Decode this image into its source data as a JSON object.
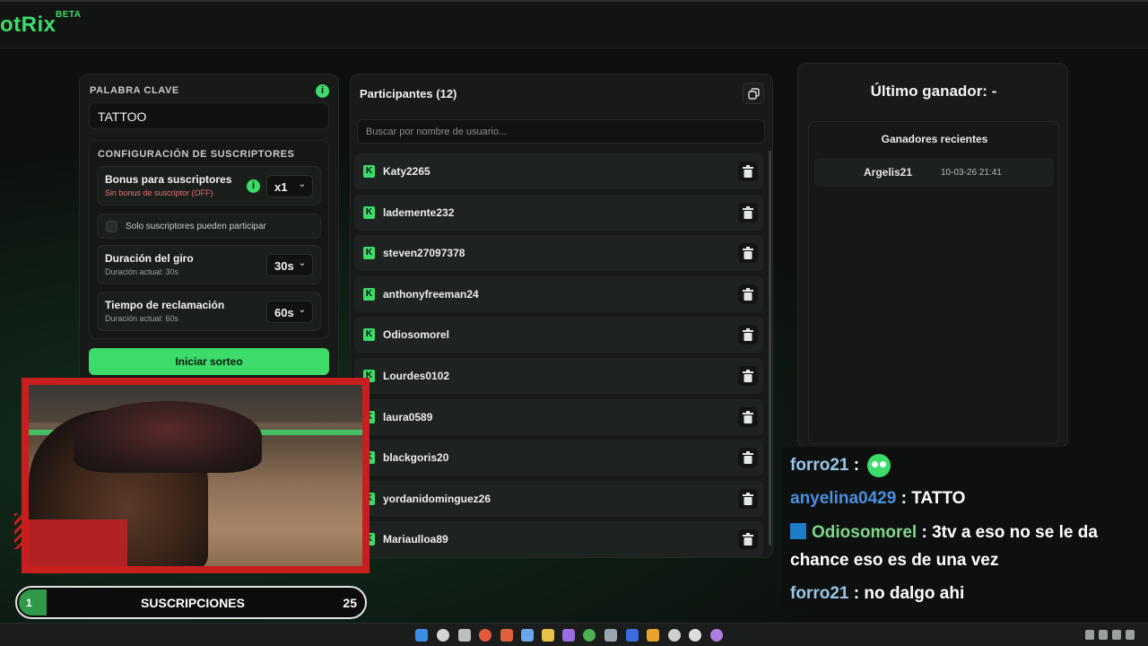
{
  "app": {
    "logo": "otRix",
    "beta": "BETA"
  },
  "keyword": {
    "label": "PALABRA CLAVE",
    "value": "TATTOO",
    "info": "i"
  },
  "subscriber_config": {
    "title": "CONFIGURACIÓN DE SUSCRIPTORES",
    "bonus": {
      "title": "Bonus para suscriptores",
      "subtitle": "Sin bonus de suscriptor (OFF)",
      "value": "x1",
      "info": "i"
    },
    "only_subs": {
      "label": "Solo suscriptores pueden participar",
      "checked": false
    },
    "spin_duration": {
      "title": "Duración del giro",
      "subtitle": "Duración actual: 30s",
      "value": "30s"
    },
    "claim_time": {
      "title": "Tiempo de reclamación",
      "subtitle": "Duración actual: 60s",
      "value": "60s"
    }
  },
  "start_button": "Iniciar sorteo",
  "participants": {
    "title": "Participantes (12)",
    "search_placeholder": "Buscar por nombre de usuario...",
    "list": [
      "Katy2265",
      "lademente232",
      "steven27097378",
      "anthonyfreeman24",
      "Odiosomorel",
      "Lourdes0102",
      "laura0589",
      "blackgoris20",
      "yordanidominguez26",
      "Mariaulloa89"
    ]
  },
  "winner": {
    "title": "Último ganador: -",
    "recent_title": "Ganadores recientes",
    "recent": [
      {
        "name": "Argelis21",
        "date": "10-03-26 21:41"
      }
    ]
  },
  "subs_bar": {
    "level": "1",
    "label": "SUSCRIPCIONES",
    "count": "25"
  },
  "chat": [
    {
      "user": "forro21",
      "sep": " : ",
      "text": ""
    },
    {
      "user": "anyelina0429",
      "sep": " : ",
      "text": "TATTO"
    },
    {
      "user": "Odiosomorel",
      "sep": " : ",
      "text": "3tv a eso no se le da chance eso es de una vez"
    },
    {
      "user": "forro21",
      "sep": " : ",
      "text": "no dalgo ahi"
    }
  ],
  "colors": {
    "accent": "#3ddc6a",
    "background": "#0d100e",
    "panel": "#171a18",
    "webcam_frame": "#c81e1e"
  }
}
